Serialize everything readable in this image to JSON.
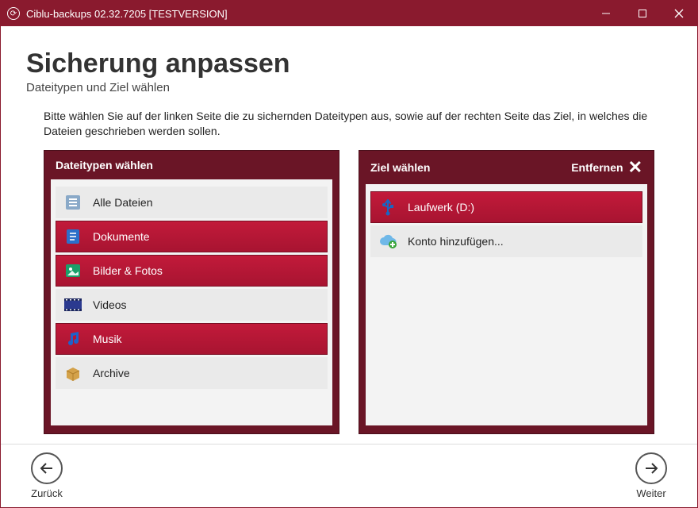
{
  "window": {
    "title": "Ciblu-backups 02.32.7205 [TESTVERSION]"
  },
  "page": {
    "title": "Sicherung anpassen",
    "subtitle": "Dateitypen und Ziel wählen",
    "instructions": "Bitte wählen Sie auf der linken Seite die zu sichernden Dateitypen aus, sowie auf der rechten Seite das Ziel, in welches die Dateien geschrieben werden sollen."
  },
  "filetypes_panel": {
    "header": "Dateitypen wählen",
    "items": [
      {
        "icon": "lines-icon",
        "label": "Alle Dateien",
        "selected": false
      },
      {
        "icon": "document-icon",
        "label": "Dokumente",
        "selected": true
      },
      {
        "icon": "image-icon",
        "label": "Bilder & Fotos",
        "selected": true
      },
      {
        "icon": "film-icon",
        "label": "Videos",
        "selected": false
      },
      {
        "icon": "music-icon",
        "label": "Musik",
        "selected": true
      },
      {
        "icon": "box-icon",
        "label": "Archive",
        "selected": false
      }
    ]
  },
  "target_panel": {
    "header": "Ziel wählen",
    "remove_label": "Entfernen",
    "items": [
      {
        "icon": "usb-icon",
        "label": "Laufwerk (D:)",
        "selected": true
      },
      {
        "icon": "cloud-add-icon",
        "label": "Konto hinzufügen...",
        "selected": false
      }
    ]
  },
  "nav": {
    "back": "Zurück",
    "next": "Weiter"
  }
}
